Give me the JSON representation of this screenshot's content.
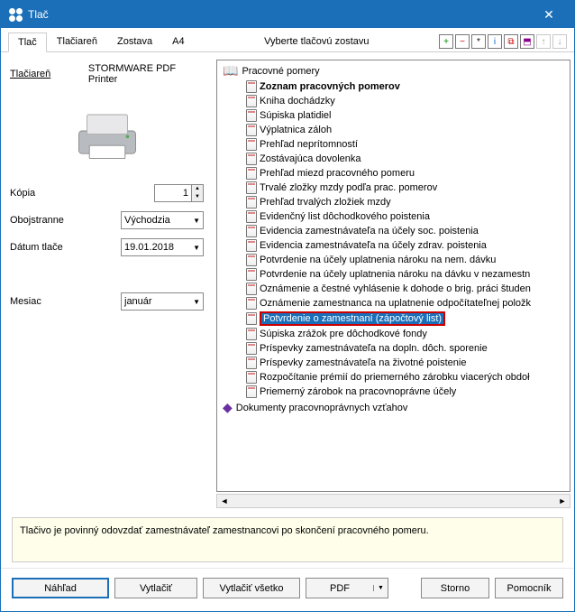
{
  "window_title": "Tlač",
  "tabs": [
    "Tlač",
    "Tlačiareň",
    "Zostava",
    "A4"
  ],
  "active_tab": "Tlač",
  "center_label": "Vyberte tlačovú zostavu",
  "icon_buttons": [
    "+",
    "−",
    "*",
    "i",
    "⧉",
    "⬒",
    "↑",
    "↓"
  ],
  "left": {
    "printer_label": "Tlačiareň",
    "printer_value": "STORMWARE PDF Printer",
    "copies_label": "Kópia",
    "copies_value": "1",
    "duplex_label": "Obojstranne",
    "duplex_value": "Východzia",
    "date_label": "Dátum tlače",
    "date_value": "19.01.2018",
    "month_label": "Mesiac",
    "month_value": "január"
  },
  "tree": {
    "root": "Pracovné pomery",
    "items": [
      {
        "label": "Zoznam pracovných pomerov",
        "bold": true
      },
      {
        "label": "Kniha dochádzky"
      },
      {
        "label": "Súpiska platidiel"
      },
      {
        "label": "Výplatnica záloh"
      },
      {
        "label": "Prehľad neprítomností"
      },
      {
        "label": "Zostávajúca dovolenka"
      },
      {
        "label": "Prehľad miezd pracovného pomeru"
      },
      {
        "label": "Trvalé zložky mzdy podľa prac. pomerov"
      },
      {
        "label": "Prehľad trvalých zložiek mzdy"
      },
      {
        "label": "Evidenčný list dôchodkového poistenia"
      },
      {
        "label": "Evidencia zamestnávateľa na účely soc. poistenia"
      },
      {
        "label": "Evidencia zamestnávateľa na účely zdrav. poistenia"
      },
      {
        "label": "Potvrdenie na účely uplatnenia nároku na nem. dávku"
      },
      {
        "label": "Potvrdenie na účely uplatnenia nároku na dávku v nezamestn"
      },
      {
        "label": "Oznámenie a čestné vyhlásenie k dohode o brig. práci študen"
      },
      {
        "label": "Oznámenie zamestnanca na uplatnenie odpočítateľnej položk"
      },
      {
        "label": "Potvrdenie o zamestnaní (zápočtový list)",
        "selected": true
      },
      {
        "label": "Súpiska zrážok pre dôchodkové fondy"
      },
      {
        "label": "Príspevky zamestnávateľa na dopln. dôch. sporenie"
      },
      {
        "label": "Príspevky zamestnávateľa na životné poistenie"
      },
      {
        "label": "Rozpočítanie prémií do priemerného zárobku viacerých obdoł"
      },
      {
        "label": "Priemerný zárobok na pracovnoprávne účely"
      }
    ],
    "root2": "Dokumenty pracovnoprávnych vzťahov"
  },
  "description": "Tlačivo je povinný odovzdať zamestnávateľ zamestnancovi po skončení pracovného pomeru.",
  "buttons": {
    "preview": "Náhľad",
    "print": "Vytlačiť",
    "print_all": "Vytlačiť všetko",
    "pdf": "PDF",
    "cancel": "Storno",
    "help": "Pomocník"
  }
}
